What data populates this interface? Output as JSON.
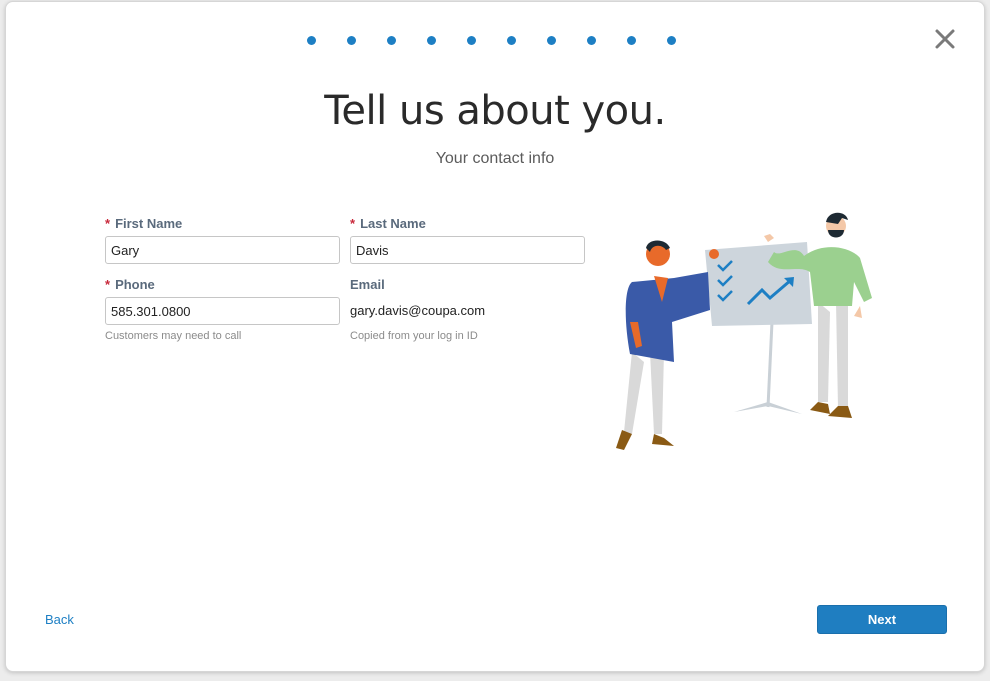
{
  "wizard": {
    "step_count": 10,
    "accent_color": "#1d7fc4"
  },
  "close_icon": "close-icon",
  "header": {
    "title": "Tell us about you.",
    "subtitle": "Your contact info"
  },
  "form": {
    "first_name": {
      "required_mark": "*",
      "label": "First Name",
      "value": "Gary"
    },
    "last_name": {
      "required_mark": "*",
      "label": "Last Name",
      "value": "Davis"
    },
    "phone": {
      "required_mark": "*",
      "label": "Phone",
      "value": "585.301.0800",
      "hint": "Customers may need to call"
    },
    "email": {
      "label": "Email",
      "value": "gary.davis@coupa.com",
      "hint": "Copied from your log in ID"
    }
  },
  "illustration": "two-people-presenting-chart-illustration",
  "footer": {
    "back_label": "Back",
    "next_label": "Next",
    "next_color": "#1f7ec1"
  }
}
